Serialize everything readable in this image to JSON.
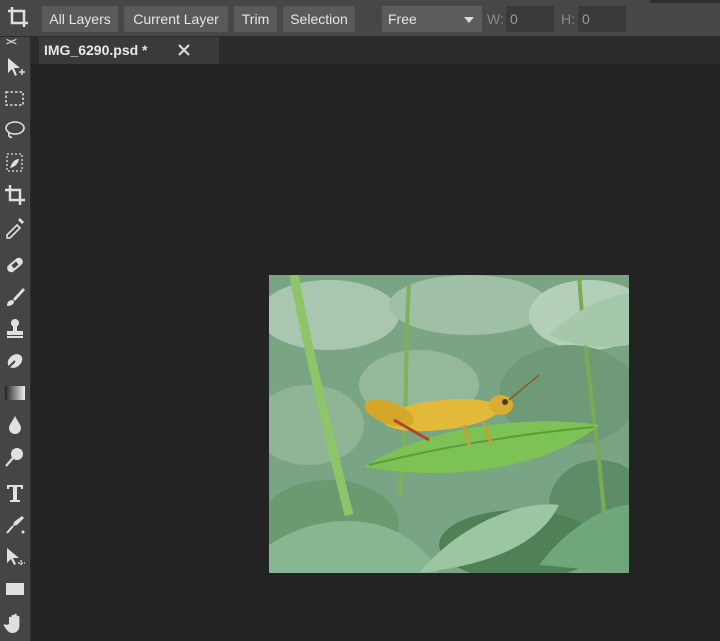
{
  "options_bar": {
    "crop_icon": "crop-icon",
    "buttons": [
      "All Layers",
      "Current Layer",
      "Trim",
      "Selection"
    ],
    "ratio_select": "Free",
    "width_label": "W:",
    "width_value": "0",
    "height_label": "H:",
    "height_value": "0"
  },
  "toolbar": {
    "collapse_glyph": "><",
    "tools": [
      "move-icon",
      "marquee-icon",
      "lasso-icon",
      "magic-wand-icon",
      "crop-icon",
      "eyedropper-icon",
      "healing-icon",
      "brush-icon",
      "stamp-icon",
      "eraser-icon",
      "gradient-icon",
      "blur-icon",
      "dodge-icon",
      "text-icon",
      "pen-icon",
      "path-select-icon",
      "shape-icon",
      "hand-icon"
    ]
  },
  "document_tab": {
    "title": "IMG_6290.psd *",
    "close_icon": "close-icon"
  },
  "canvas": {
    "image_subject": "grasshopper on leaf",
    "background_color": "#232323"
  }
}
